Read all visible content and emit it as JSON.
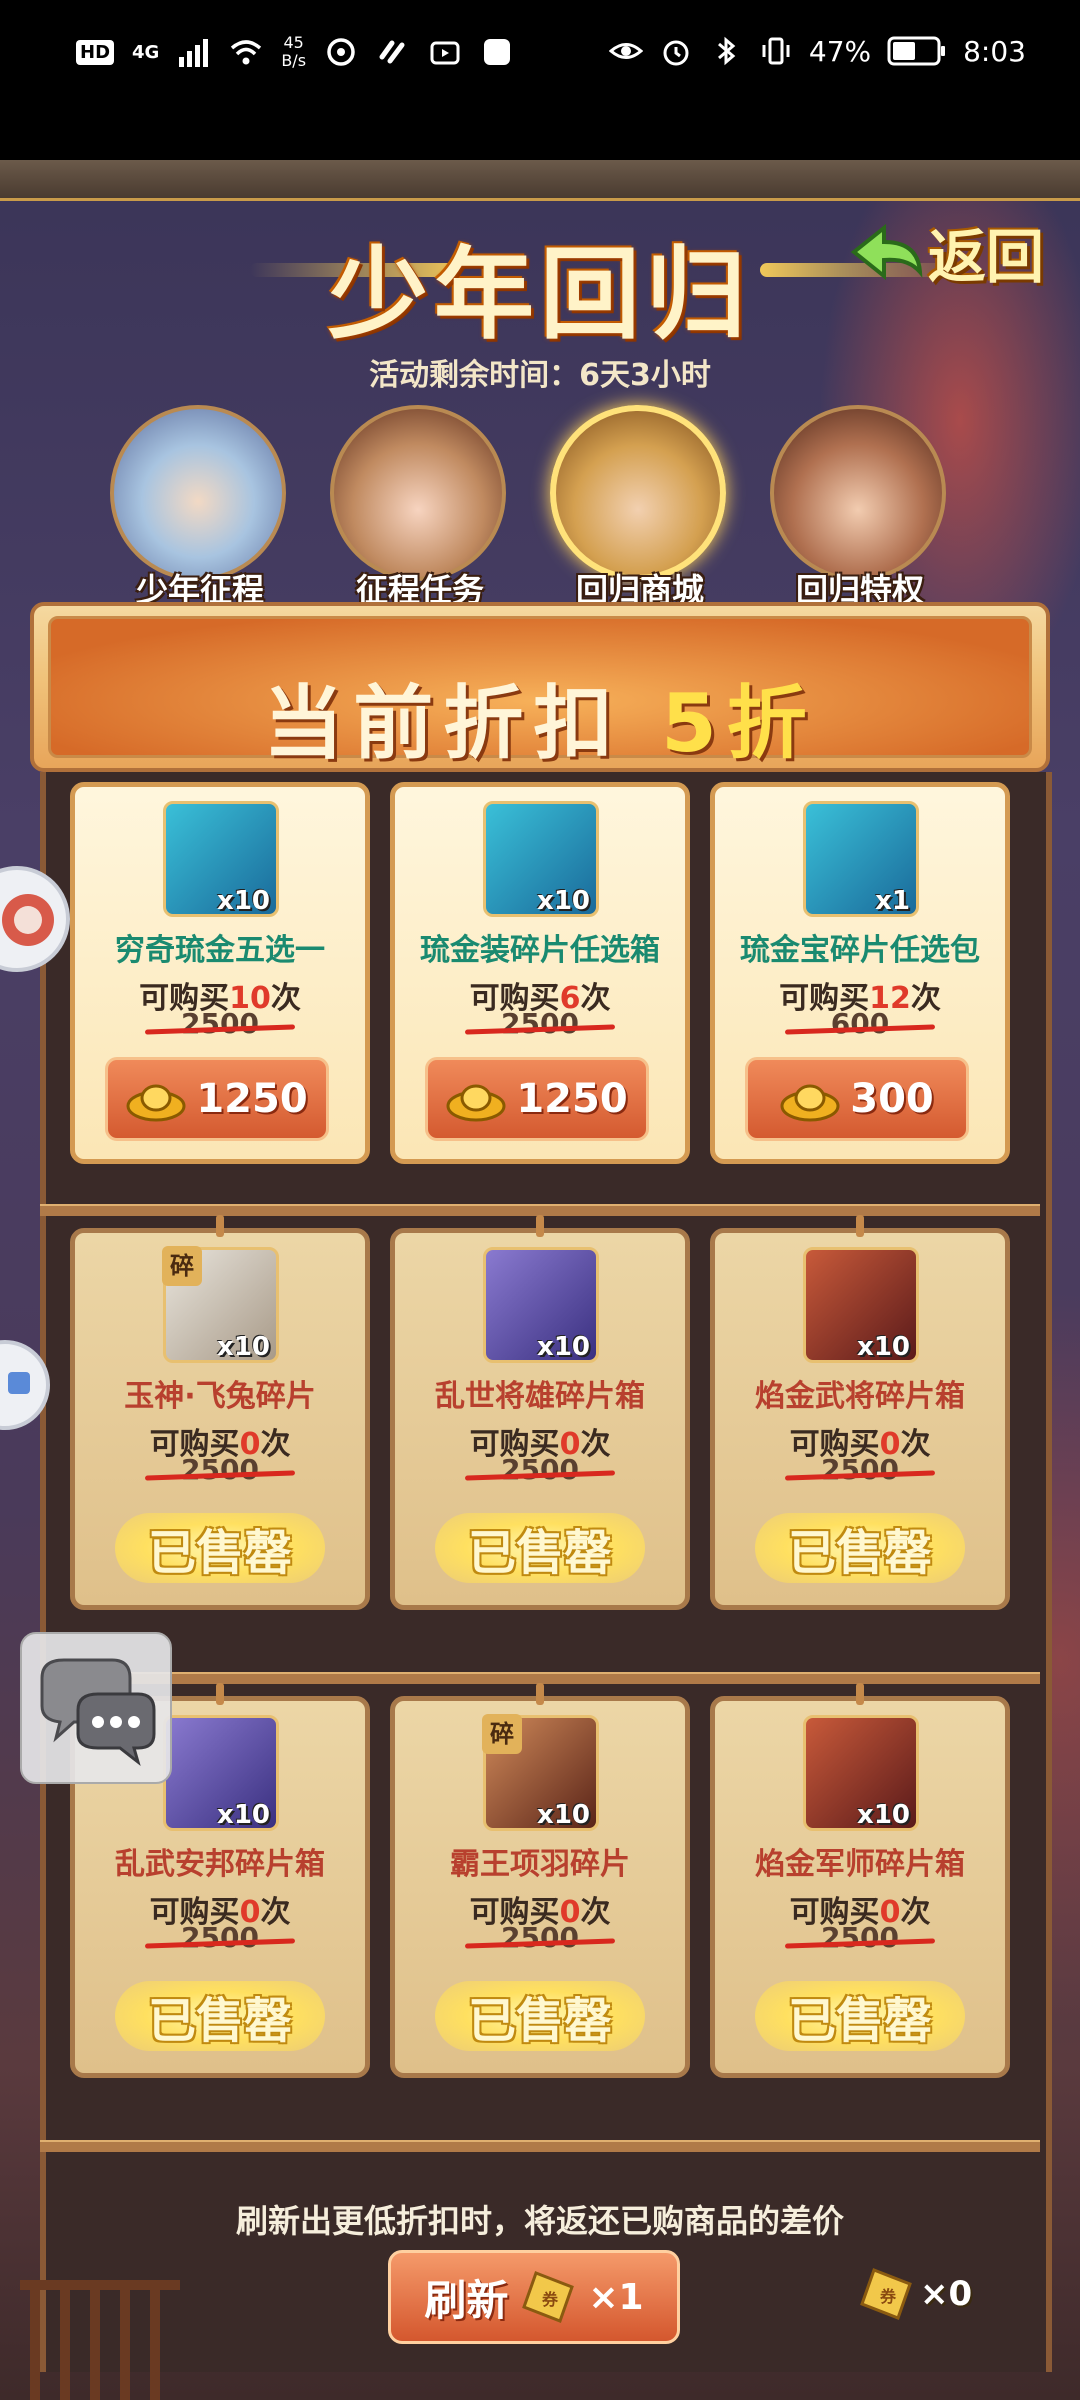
{
  "status_bar": {
    "hd": "HD",
    "network": "4G",
    "speed_value": "45",
    "speed_unit": "B/s",
    "battery": "47%",
    "time": "8:03"
  },
  "header": {
    "title": "少年回归",
    "back_label": "返回",
    "timer_label": "活动剩余时间：",
    "timer_value": "6天3小时"
  },
  "tabs": [
    {
      "label": "少年征程",
      "active": false
    },
    {
      "label": "征程任务",
      "active": false
    },
    {
      "label": "回归商城",
      "active": true
    },
    {
      "label": "回归特权",
      "active": false
    }
  ],
  "banner": {
    "prefix": "当前折扣 ",
    "discount": "5折"
  },
  "shop": {
    "limit_prefix": "可购买",
    "limit_suffix": "次",
    "sold_out_label": "已售罄",
    "fragment_badge": "碎",
    "items": [
      {
        "name": "穷奇琉金五选一",
        "qty": "x10",
        "limit": "10",
        "original_price": "2500",
        "price": "1250",
        "sold_out": false,
        "accent": "#2aa0c8"
      },
      {
        "name": "琉金装碎片任选箱",
        "qty": "x10",
        "limit": "6",
        "original_price": "2500",
        "price": "1250",
        "sold_out": false,
        "accent": "#2aa0c8"
      },
      {
        "name": "琉金宝碎片任选包",
        "qty": "x1",
        "limit": "12",
        "original_price": "600",
        "price": "300",
        "sold_out": false,
        "accent": "#2aa0c8"
      },
      {
        "name": "玉神·飞兔碎片",
        "qty": "x10",
        "limit": "0",
        "original_price": "2500",
        "sold_out": true,
        "accent": "#c8b090"
      },
      {
        "name": "乱世将雄碎片箱",
        "qty": "x10",
        "limit": "0",
        "original_price": "2500",
        "sold_out": true,
        "accent": "#6a5aa8"
      },
      {
        "name": "焰金武将碎片箱",
        "qty": "x10",
        "limit": "0",
        "original_price": "2500",
        "sold_out": true,
        "accent": "#a83a3a"
      },
      {
        "name": "乱武安邦碎片箱",
        "qty": "x10",
        "limit": "0",
        "original_price": "2500",
        "sold_out": true,
        "accent": "#6a5aa8"
      },
      {
        "name": "霸王项羽碎片",
        "qty": "x10",
        "limit": "0",
        "original_price": "2500",
        "sold_out": true,
        "accent": "#a84a3a"
      },
      {
        "name": "焰金军师碎片箱",
        "qty": "x10",
        "limit": "0",
        "original_price": "2500",
        "sold_out": true,
        "accent": "#a83a3a"
      }
    ]
  },
  "footer": {
    "note": "刷新出更低折扣时，将返还已购商品的差价",
    "refresh_label": "刷新",
    "refresh_cost": "×1",
    "ticket_stock": "×0"
  },
  "colors": {
    "accent_gold": "#ffe04a",
    "sold_text": "#b8402e",
    "available_text": "#1a8a70"
  }
}
